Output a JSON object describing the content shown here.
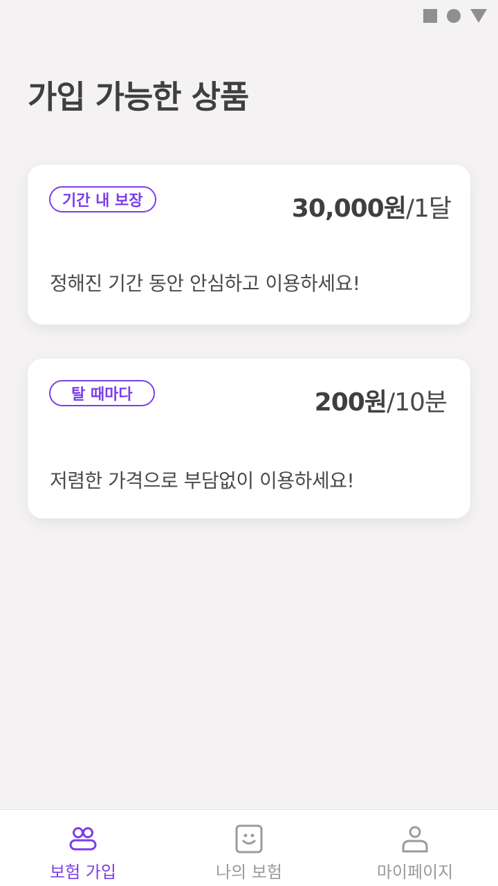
{
  "page": {
    "title": "가입 가능한 상품"
  },
  "products": [
    {
      "badge": "기간 내 보장",
      "price_amount": "30,000원",
      "price_unit": "/1달",
      "description": "정해진 기간 동안 안심하고 이용하세요!"
    },
    {
      "badge": "탈 때마다",
      "price_amount": "200원",
      "price_unit": "/10분",
      "description": "저렴한 가격으로 부담없이 이용하세요!"
    }
  ],
  "nav": {
    "items": [
      {
        "label": "보험 가입",
        "icon": "people-icon",
        "active": true
      },
      {
        "label": "나의 보험",
        "icon": "smile-face-icon",
        "active": false
      },
      {
        "label": "마이페이지",
        "icon": "person-icon",
        "active": false
      }
    ]
  },
  "colors": {
    "accent": "#7a3ee8",
    "background": "#f4f2f3",
    "inactive": "#9a9a9a"
  }
}
